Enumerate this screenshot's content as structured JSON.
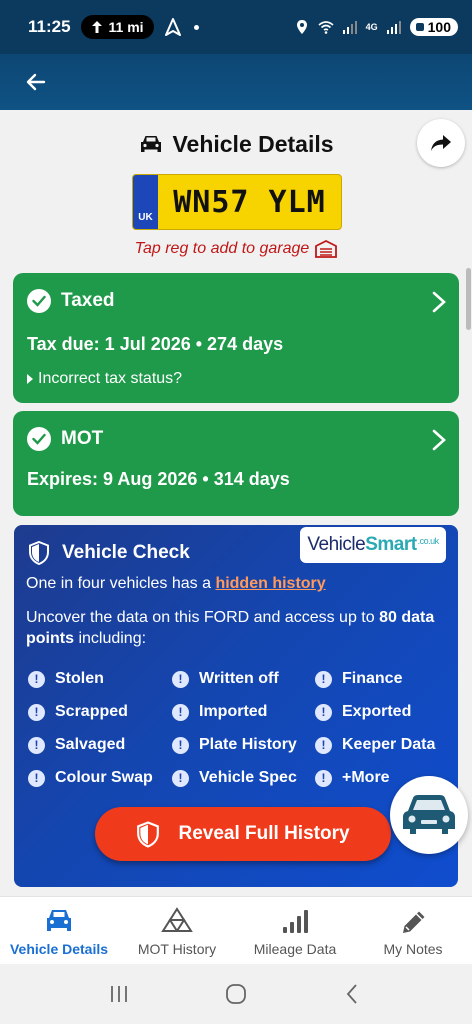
{
  "status_bar": {
    "time": "11:25",
    "distance": "11 mi",
    "battery": "100",
    "network": "4G"
  },
  "header": {
    "title": "Vehicle Details",
    "icons": {
      "back": "arrow-left-icon",
      "share": "share-arrow-icon",
      "car": "car-icon"
    }
  },
  "plate": {
    "country": "UK",
    "registration": "WN57 YLM",
    "garage_hint": "Tap reg to add to garage"
  },
  "tax_card": {
    "status": "Taxed",
    "detail": "Tax due: 1 Jul 2026 • 274 days",
    "link": "Incorrect tax status?",
    "color": "#1f9a4a"
  },
  "mot_card": {
    "status": "MOT",
    "detail": "Expires: 9 Aug 2026 • 314 days",
    "color": "#1f9a4a"
  },
  "vehicle_check": {
    "title": "Vehicle Check",
    "logo_part1": "Vehicle",
    "logo_part2": "Smart",
    "logo_suffix": ".co.uk",
    "line1_prefix": "One in four vehicles has a ",
    "line1_highlight": "hidden history",
    "line2_prefix": "Uncover the data on this FORD and access up to ",
    "line2_bold": "80 data points",
    "line2_suffix": " including:",
    "items": [
      "Stolen",
      "Written off",
      "Finance",
      "Scrapped",
      "Imported",
      "Exported",
      "Salvaged",
      "Plate History",
      "Keeper Data",
      "Colour Swap",
      "Vehicle Spec",
      "+More"
    ],
    "button_label": "Reveal Full History",
    "button_color": "#f03a1c"
  },
  "bottom_nav": [
    {
      "label": "Vehicle Details",
      "icon": "car-icon",
      "active": true
    },
    {
      "label": "MOT History",
      "icon": "mot-triangle-icon",
      "active": false
    },
    {
      "label": "Mileage Data",
      "icon": "bar-signal-icon",
      "active": false
    },
    {
      "label": "My Notes",
      "icon": "pencil-icon",
      "active": false
    }
  ],
  "colors": {
    "app_bar": "#0f5284",
    "accent": "#1a6fd2",
    "warning_text": "#c01818"
  }
}
